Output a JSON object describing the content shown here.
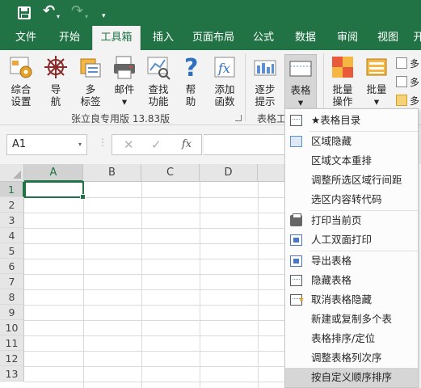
{
  "qat": {
    "save_icon": "save-icon",
    "undo_icon": "↶",
    "undo_dd": "▾",
    "redo_icon": "↷",
    "redo_dd": "▾",
    "more": "▾"
  },
  "tabs": [
    {
      "label": "文件"
    },
    {
      "label": "开始"
    },
    {
      "label": "工具箱",
      "active": true
    },
    {
      "label": "插入"
    },
    {
      "label": "页面布局"
    },
    {
      "label": "公式"
    },
    {
      "label": "数据"
    },
    {
      "label": "审阅"
    },
    {
      "label": "视图"
    },
    {
      "label": "开"
    }
  ],
  "ribbon": {
    "buttons": [
      {
        "label1": "综合",
        "label2": "设置"
      },
      {
        "label1": "导",
        "label2": "航"
      },
      {
        "label1": "多",
        "label2": "标签"
      },
      {
        "label1": "邮件",
        "label2": "▾"
      },
      {
        "label1": "查找",
        "label2": "功能"
      },
      {
        "label1": "帮",
        "label2": "助"
      },
      {
        "label1": "添加",
        "label2": "函数"
      },
      {
        "label1": "逐步",
        "label2": "提示"
      },
      {
        "label1": "表格",
        "label2": "▾"
      },
      {
        "label1": "批量",
        "label2": "操作"
      },
      {
        "label1": "批量",
        "label2": "▾"
      }
    ],
    "group_label_1": "张立良专用版 13.83版",
    "group_label_2": "表格工",
    "small_items": [
      "多",
      "多",
      "多"
    ]
  },
  "formula_bar": {
    "name_box": "A1",
    "name_box_dd": "▾",
    "dots": "⋮",
    "cancel": "✕",
    "enter": "✓",
    "fx": "fx"
  },
  "grid": {
    "columns": [
      "A",
      "B",
      "C",
      "D"
    ],
    "rows": [
      "1",
      "2",
      "3",
      "4",
      "5",
      "6",
      "7",
      "8",
      "9",
      "10",
      "11",
      "12",
      "13"
    ],
    "active_cell": "A1"
  },
  "dropdown": {
    "items": [
      {
        "label": "★表格目录",
        "icon": "table-icon"
      },
      {
        "label": "区域隐藏",
        "icon": "hide-range-icon"
      },
      {
        "label": "区域文本重排",
        "icon": ""
      },
      {
        "label": "调整所选区域行间距",
        "icon": ""
      },
      {
        "label": "选区内容转代码",
        "icon": ""
      },
      {
        "label": "打印当前页",
        "icon": "printer-icon"
      },
      {
        "label": "人工双面打印",
        "icon": "duplex-print-icon"
      },
      {
        "label": "导出表格",
        "icon": "export-icon"
      },
      {
        "label": "隐藏表格",
        "icon": "hide-sheet-icon"
      },
      {
        "label": "取消表格隐藏",
        "icon": "unhide-sheet-icon"
      },
      {
        "label": "新建或复制多个表",
        "icon": ""
      },
      {
        "label": "表格排序/定位",
        "icon": ""
      },
      {
        "label": "调整表格列次序",
        "icon": ""
      },
      {
        "label": "按自定义顺序排序",
        "icon": "",
        "highlighted": true
      }
    ]
  },
  "colors": {
    "brand": "#217346",
    "ribbon_bg": "#f3f3f3"
  }
}
